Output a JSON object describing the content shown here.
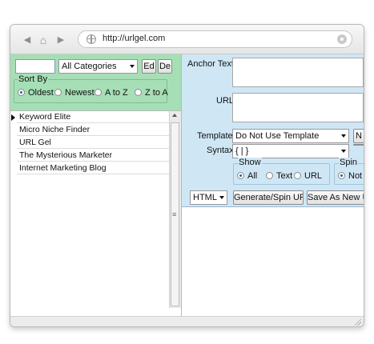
{
  "browser": {
    "url": "http://urlgel.com",
    "back_icon": "◀",
    "home_icon": "⌂",
    "forward_icon": "▶"
  },
  "filter": {
    "search_value": "",
    "category_selected": "All Categories",
    "edit_label": "Ed",
    "delete_label": "De"
  },
  "sort": {
    "title": "Sort By",
    "options": [
      "Oldest",
      "Newest",
      "A to Z",
      "Z to A"
    ],
    "selected": "Oldest"
  },
  "list": {
    "items": [
      "Keyword Elite",
      "Micro Niche Finder",
      "URL Gel",
      "The Mysterious Marketer",
      "Internet Marketing Blog"
    ],
    "selected_index": 0
  },
  "form": {
    "anchor_text_label": "Anchor Text",
    "url_label": "URL",
    "template_label": "Template",
    "template_value": "Do Not Use Template",
    "new_button_label": "N",
    "syntax_label": "Syntax",
    "syntax_value": "{ | }",
    "show_title": "Show",
    "show_options": [
      "All",
      "Text",
      "URL"
    ],
    "show_selected": "All",
    "spin_title": "Spin",
    "spin_option": "Not"
  },
  "actions": {
    "format_value": "HTML",
    "generate_label": "Generate/Spin URL",
    "save_label": "Save As New UI"
  },
  "colors": {
    "left_panel": "#a6dfb5",
    "right_panel": "#cfe7f5"
  }
}
